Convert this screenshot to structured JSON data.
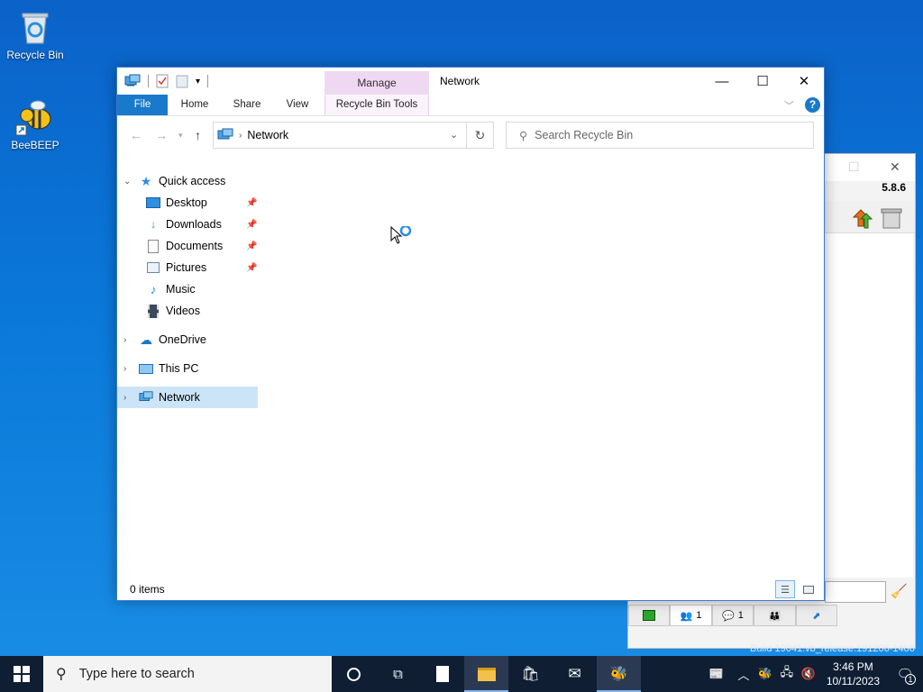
{
  "desktop": {
    "icons": [
      {
        "label": "Recycle Bin",
        "icon": "recycle-bin-icon"
      },
      {
        "label": "BeeBEEP",
        "icon": "beebeep-icon"
      }
    ]
  },
  "beebeep_window": {
    "version": "5.8.6",
    "tabs": [
      {
        "icon": "chat-screen-icon",
        "count": ""
      },
      {
        "icon": "users-icon",
        "count": "1"
      },
      {
        "icon": "messages-icon",
        "count": "1"
      },
      {
        "icon": "groups-icon",
        "count": ""
      },
      {
        "icon": "share-icon",
        "count": ""
      }
    ]
  },
  "build_text": "Build 19041.vb_release.191206-1406",
  "explorer": {
    "title": "Network",
    "contextual_tab_group": "Manage",
    "ribbon_tabs": [
      "File",
      "Home",
      "Share",
      "View"
    ],
    "contextual_tab": "Recycle Bin Tools",
    "address": {
      "crumb": "Network"
    },
    "search": {
      "placeholder": "Search Recycle Bin"
    },
    "nav_pane": {
      "quick_access": "Quick access",
      "pinned": [
        "Desktop",
        "Downloads",
        "Documents",
        "Pictures"
      ],
      "unpinned": [
        "Music",
        "Videos"
      ],
      "onedrive": "OneDrive",
      "this_pc": "This PC",
      "network": "Network"
    },
    "status": "0 items"
  },
  "taskbar": {
    "search_placeholder": "Type here to search",
    "time": "3:46 PM",
    "date": "10/11/2023",
    "notification_count": "1"
  },
  "colors": {
    "accent": "#1979ca",
    "selection": "#cce4f7",
    "taskbar": "#0f1e33",
    "manage_tab": "#efd9f2"
  }
}
